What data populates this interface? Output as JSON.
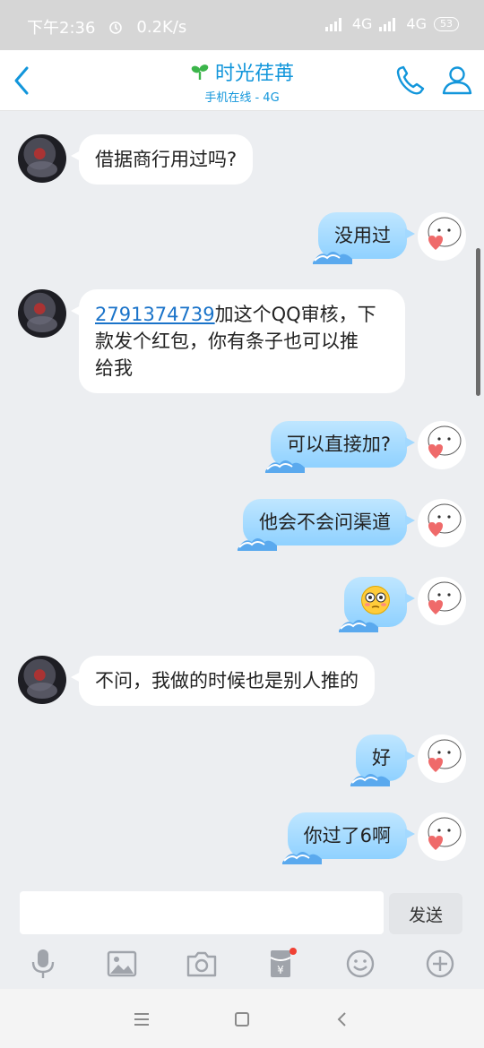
{
  "status_bar": {
    "time": "下午2:36",
    "net_speed": "0.2K/s",
    "network1": "4G",
    "network2": "4G",
    "battery": "53"
  },
  "header": {
    "title": "时光荏苒",
    "subtitle": "手机在线 - 4G"
  },
  "messages": [
    {
      "side": "left",
      "text": "借据商行用过吗?"
    },
    {
      "side": "right",
      "text": "没用过"
    },
    {
      "side": "left",
      "link": "2791374739",
      "line1_rest": "加这个QQ审核，下",
      "line2": "款发个红包，你有条子也可以推",
      "line3": "给我"
    },
    {
      "side": "right",
      "text": "可以直接加?"
    },
    {
      "side": "right",
      "text": "他会不会问渠道"
    },
    {
      "side": "right",
      "text": "😳"
    },
    {
      "side": "left",
      "text": "不问，我做的时候也是别人推的"
    },
    {
      "side": "right",
      "text": "好"
    },
    {
      "side": "right",
      "text": "你过了6啊"
    }
  ],
  "input": {
    "value": "",
    "send_label": "发送"
  },
  "toolbar_icons": [
    "microphone-icon",
    "image-icon",
    "camera-icon",
    "red-packet-icon",
    "emoji-icon",
    "plus-icon"
  ],
  "colors": {
    "accent": "#1296db",
    "bubble_right": "#a3d9ff",
    "bubble_left": "#ffffff",
    "background": "#eceef1"
  }
}
